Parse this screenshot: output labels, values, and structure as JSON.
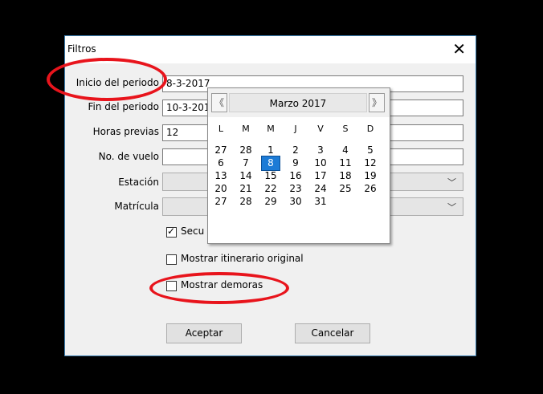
{
  "dialog": {
    "title": "Filtros",
    "close_glyph": "✕",
    "labels": {
      "inicio": "Inicio del periodo",
      "fin": "Fin del periodo",
      "horas": "Horas previas",
      "vuelo": "No. de vuelo",
      "estacion": "Estación",
      "matricula": "Matrícula"
    },
    "values": {
      "inicio": "8-3-2017",
      "fin": "10-3-201",
      "horas": "12",
      "vuelo": "",
      "estacion": "",
      "matricula": ""
    },
    "checkboxes": [
      {
        "label": "Secu",
        "checked": true
      },
      {
        "label": "Mostrar itinerario original",
        "checked": false
      },
      {
        "label": "Mostrar demoras",
        "checked": false
      }
    ],
    "buttons": {
      "ok": "Aceptar",
      "cancel": "Cancelar"
    }
  },
  "calendar": {
    "month_label": "Marzo 2017",
    "prev_glyph": "《",
    "next_glyph": "》",
    "weekdays": [
      "L",
      "M",
      "M",
      "J",
      "V",
      "S",
      "D"
    ],
    "weeks": [
      [
        "27",
        "28",
        "1",
        "2",
        "3",
        "4",
        "5"
      ],
      [
        "6",
        "7",
        "8",
        "9",
        "10",
        "11",
        "12"
      ],
      [
        "13",
        "14",
        "15",
        "16",
        "17",
        "18",
        "19"
      ],
      [
        "20",
        "21",
        "22",
        "23",
        "24",
        "25",
        "26"
      ],
      [
        "27",
        "28",
        "29",
        "30",
        "31",
        "",
        ""
      ]
    ],
    "selected": "8"
  },
  "colors": {
    "annotation": "#e8141c",
    "selection": "#1c7bd6",
    "border": "#3c7fb1"
  }
}
